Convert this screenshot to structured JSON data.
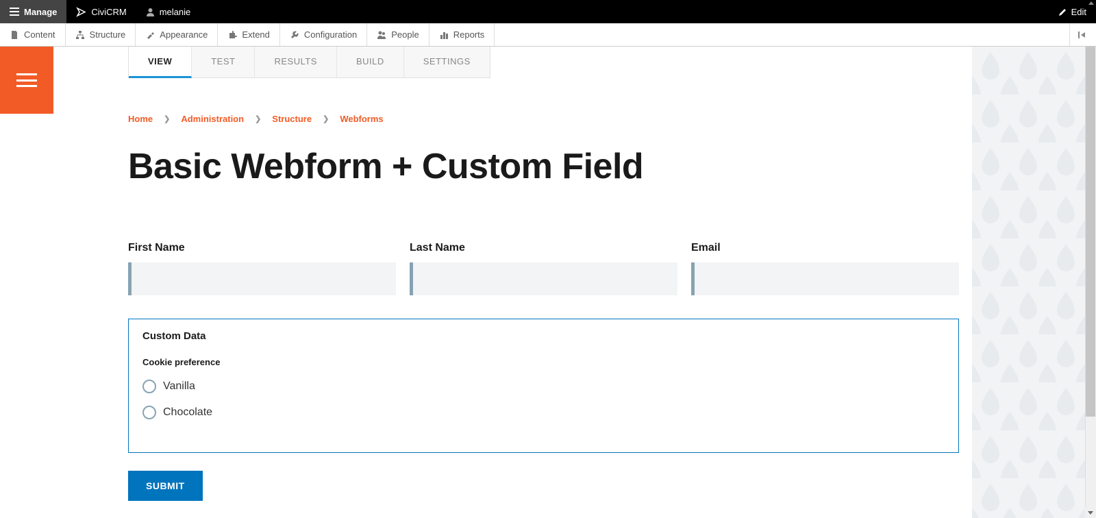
{
  "topbar": {
    "manage": "Manage",
    "civicrm": "CiviCRM",
    "user": "melanie",
    "edit": "Edit"
  },
  "secondbar": {
    "items": [
      {
        "label": "Content",
        "icon": "document-icon"
      },
      {
        "label": "Structure",
        "icon": "structure-icon"
      },
      {
        "label": "Appearance",
        "icon": "appearance-icon"
      },
      {
        "label": "Extend",
        "icon": "extend-icon"
      },
      {
        "label": "Configuration",
        "icon": "configuration-icon"
      },
      {
        "label": "People",
        "icon": "people-icon"
      },
      {
        "label": "Reports",
        "icon": "reports-icon"
      }
    ]
  },
  "tabs": [
    {
      "label": "VIEW",
      "active": true
    },
    {
      "label": "TEST",
      "active": false
    },
    {
      "label": "RESULTS",
      "active": false
    },
    {
      "label": "BUILD",
      "active": false
    },
    {
      "label": "SETTINGS",
      "active": false
    }
  ],
  "breadcrumb": [
    "Home",
    "Administration",
    "Structure",
    "Webforms"
  ],
  "page_title": "Basic Webform + Custom Field",
  "form": {
    "fields": [
      {
        "label": "First Name",
        "value": ""
      },
      {
        "label": "Last Name",
        "value": ""
      },
      {
        "label": "Email",
        "value": ""
      }
    ],
    "fieldset": {
      "legend": "Custom Data",
      "sublabel": "Cookie preference",
      "options": [
        "Vanilla",
        "Chocolate"
      ]
    },
    "submit": "SUBMIT"
  }
}
